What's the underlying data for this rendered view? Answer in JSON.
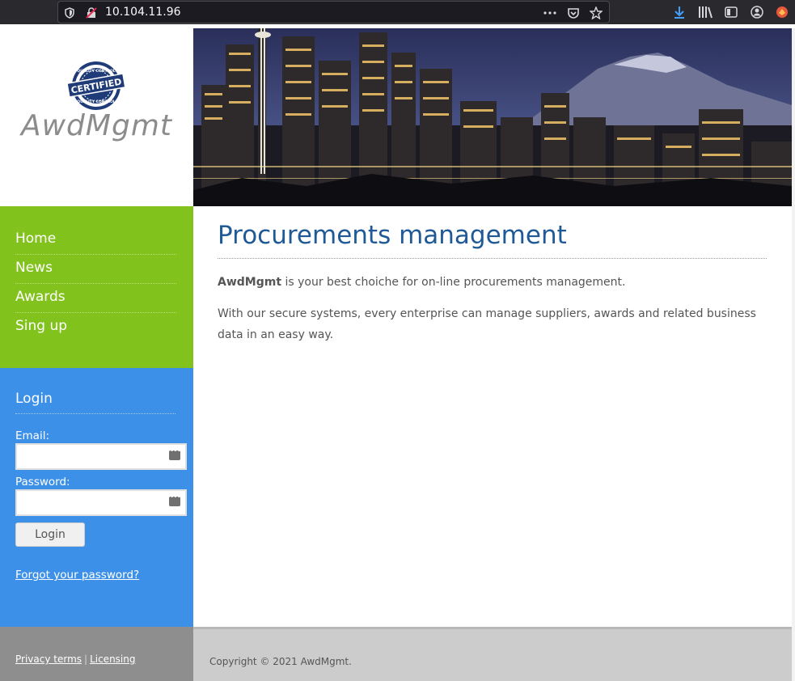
{
  "browser": {
    "url": "10.104.11.96"
  },
  "site": {
    "logo_text": "AwdMgmt",
    "seal_top_text": "QUALITY CONTROL",
    "seal_center_text": "CERTIFIED",
    "seal_bottom_text": "QUALITY CONTROL"
  },
  "nav": {
    "items": [
      {
        "label": "Home"
      },
      {
        "label": "News"
      },
      {
        "label": "Awards"
      },
      {
        "label": "Sing up"
      }
    ]
  },
  "login": {
    "title": "Login",
    "email_label": "Email:",
    "email_value": "",
    "password_label": "Password:",
    "password_value": "",
    "button_label": "Login",
    "forgot_label": "Forgot your password?"
  },
  "main": {
    "title": "Procurements management",
    "intro_brand": "AwdMgmt",
    "intro_rest": " is your best choiche for on-line procurements management.",
    "paragraph": "With our secure systems, every enterprise can manage suppliers, awards and related business data in an easy way."
  },
  "footer": {
    "privacy_label": "Privacy terms",
    "separator": "|",
    "licensing_label": "Licensing",
    "copyright": "Copyright © 2021 AwdMgmt."
  },
  "colors": {
    "nav_bg": "#82c21d",
    "login_bg": "#3d90e8",
    "title_blue": "#1f5a96",
    "footer_left": "#8e8e8e",
    "footer_right": "#cccccc"
  }
}
